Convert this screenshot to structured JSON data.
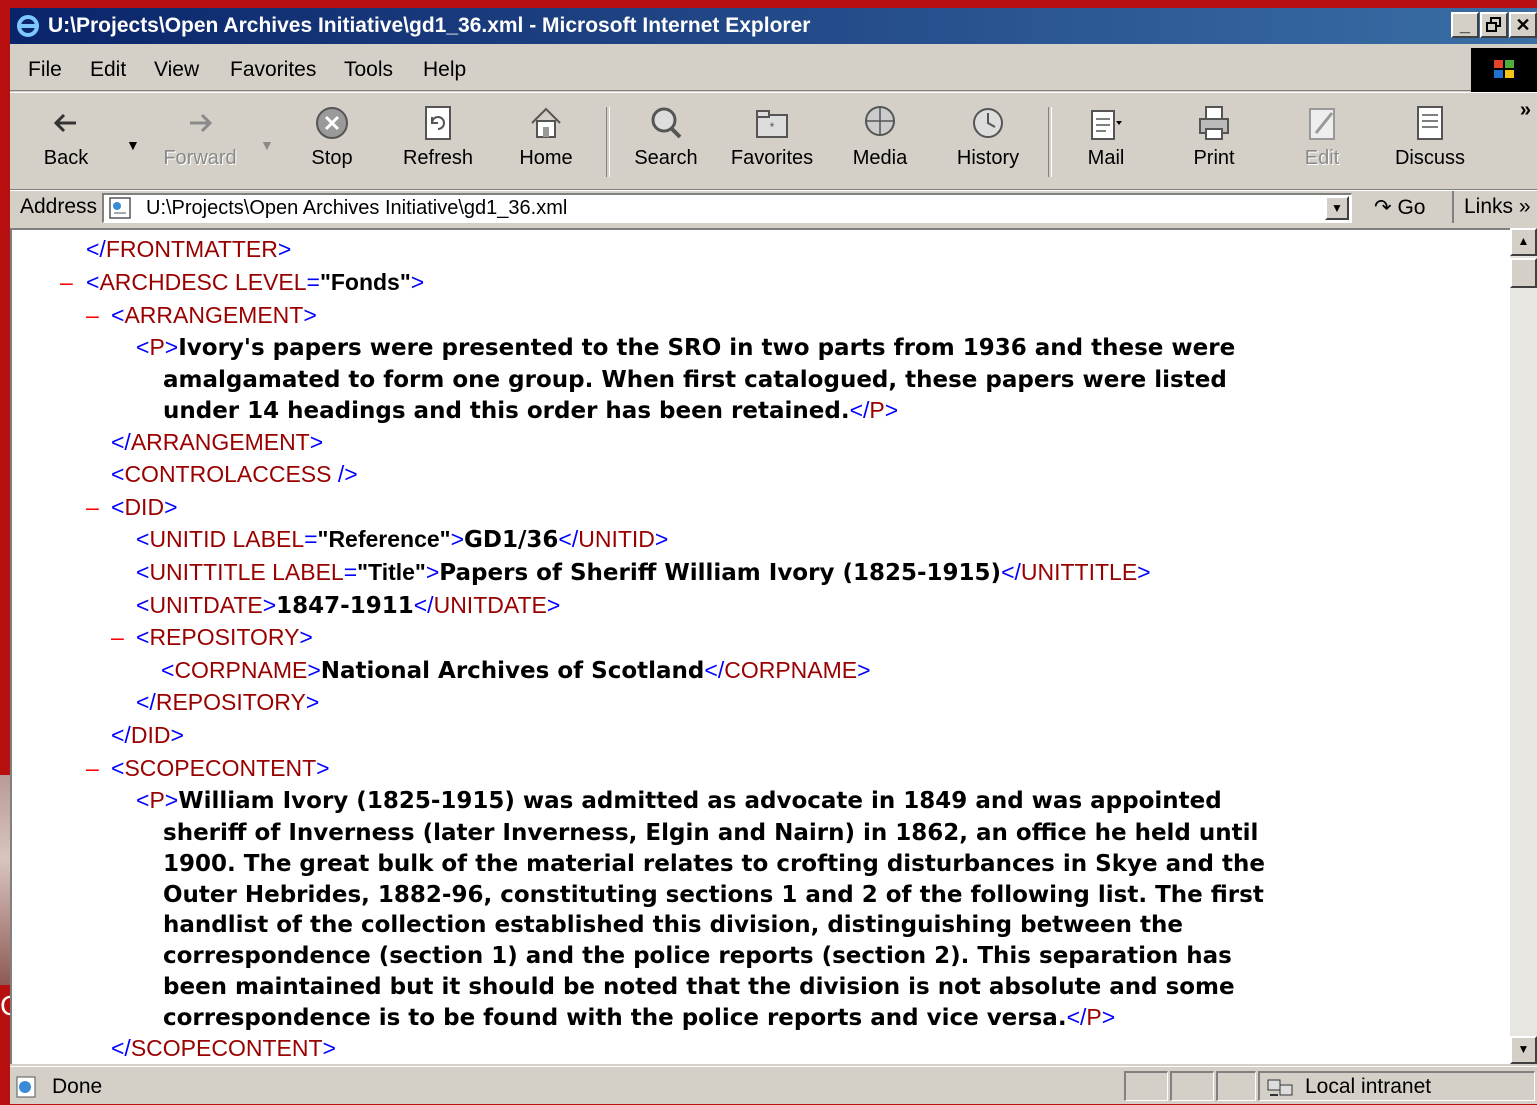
{
  "window": {
    "title": "U:\\Projects\\Open Archives Initiative\\gd1_36.xml - Microsoft Internet Explorer",
    "controls": {
      "minimize": "_",
      "maximize": "▫",
      "close": "✕"
    }
  },
  "menu": [
    "File",
    "Edit",
    "View",
    "Favorites",
    "Tools",
    "Help"
  ],
  "toolbar": {
    "back": "Back",
    "forward": "Forward",
    "stop": "Stop",
    "refresh": "Refresh",
    "home": "Home",
    "search": "Search",
    "favorites": "Favorites",
    "media": "Media",
    "history": "History",
    "mail": "Mail",
    "print": "Print",
    "edit": "Edit",
    "discuss": "Discuss",
    "more": "»"
  },
  "address": {
    "label": "Address",
    "url": "U:\\Projects\\Open Archives Initiative\\gd1_36.xml",
    "go": "Go",
    "links": "Links »"
  },
  "xml": {
    "minus": "–",
    "l1_tag": "FRONTMATTER",
    "l2_tag": "ARCHDESC",
    "l2_attr": "LEVEL",
    "l2_val": "\"Fonds\"",
    "l3_tag": "ARRANGEMENT",
    "p_tag": "P",
    "arr_p1": "Ivory's papers were presented to the SRO in two parts from 1936 and these were",
    "arr_p2": "amalgamated to form one group. When first catalogued, these papers were listed",
    "arr_p3": "under 14 headings and this order has been retained.",
    "controlaccess": "CONTROLACCESS",
    "did_tag": "DID",
    "unitid_tag": "UNITID",
    "label_attr": "LABEL",
    "unitid_label": "\"Reference\"",
    "unitid_value": "GD1/36",
    "unittitle_tag": "UNITTITLE",
    "unittitle_label": "\"Title\"",
    "unittitle_value": "Papers of Sheriff William Ivory (1825-1915)",
    "unitdate_tag": "UNITDATE",
    "unitdate_value": "1847-1911",
    "repository_tag": "REPOSITORY",
    "corpname_tag": "CORPNAME",
    "corpname_value": "National Archives of Scotland",
    "scope_tag": "SCOPECONTENT",
    "scope_lines": [
      "William Ivory (1825-1915) was admitted as advocate in 1849 and was appointed",
      "sheriff of Inverness (later Inverness, Elgin and Nairn) in 1862, an office he held until",
      "1900. The great bulk of the material relates to crofting disturbances in Skye and the",
      "Outer Hebrides, 1882-96, constituting sections 1 and 2 of the following list. The first",
      "handlist of the collection established this division, distinguishing between the",
      "correspondence (section 1) and the police reports (section 2). This separation has",
      "been maintained but it should be noted that the division is not absolute and some",
      "correspondence is to be found with the police reports and vice versa."
    ]
  },
  "status": {
    "text": "Done",
    "zone": "Local intranet"
  },
  "slide": {
    "fragment": "C"
  }
}
